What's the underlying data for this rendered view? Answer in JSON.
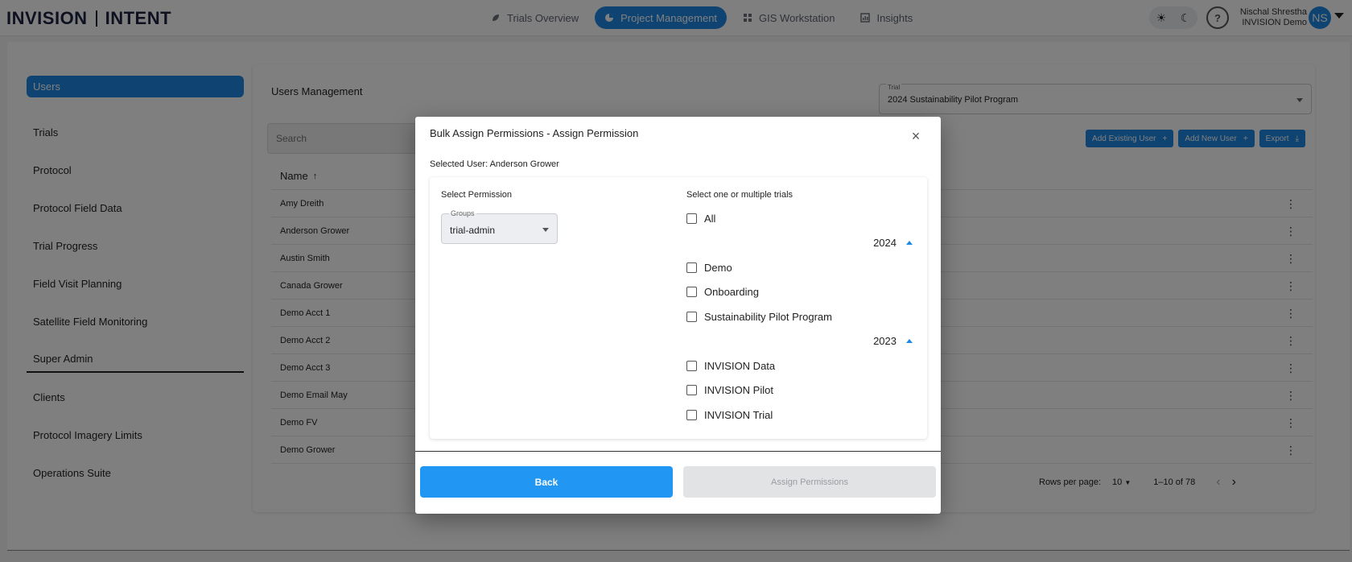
{
  "topbar": {
    "logo_left": "INVISION",
    "logo_right": "INTENT",
    "nav": [
      {
        "label": "Trials Overview",
        "icon": "leaf-icon",
        "active": false
      },
      {
        "label": "Project Management",
        "icon": "chart-pie-icon",
        "active": true
      },
      {
        "label": "GIS Workstation",
        "icon": "grid-icon",
        "active": false
      },
      {
        "label": "Insights",
        "icon": "bar-chart-icon",
        "active": false
      }
    ],
    "theme_light_icon": "☀",
    "theme_dark_icon": "☾",
    "help_icon": "?",
    "user_name": "Nischal Shrestha",
    "user_org": "INVISION Demo",
    "avatar_initials": "NS"
  },
  "sidebar": {
    "items": [
      {
        "label": "Users"
      },
      {
        "label": "Trials"
      },
      {
        "label": "Protocol"
      },
      {
        "label": "Protocol Field Data"
      },
      {
        "label": "Trial Progress"
      },
      {
        "label": "Field Visit Planning"
      },
      {
        "label": "Satellite Field Monitoring"
      }
    ],
    "section_label": "Super Admin",
    "admin_items": [
      {
        "label": "Clients"
      },
      {
        "label": "Protocol Imagery Limits"
      },
      {
        "label": "Operations Suite"
      }
    ]
  },
  "main": {
    "title": "Users Management",
    "trial_select_label": "Trial",
    "trial_select_value": "2024 Sustainability Pilot Program",
    "search_placeholder": "Search",
    "buttons": {
      "add_existing": "Add Existing User",
      "add_new": "Add New User",
      "export": "Export",
      "plus": "+",
      "export_icon": "⤓"
    },
    "table": {
      "name_header": "Name",
      "sort_icon": "↑",
      "rows": [
        "Amy Dreith",
        "Anderson Grower",
        "Austin Smith",
        "Canada Grower",
        "Demo Acct 1",
        "Demo Acct 2",
        "Demo Acct 3",
        "Demo Email May",
        "Demo FV",
        "Demo Grower"
      ]
    },
    "pager": {
      "rows_per_page_label": "Rows per page:",
      "rows_per_page_value": "10",
      "range": "1–10 of 78",
      "prev": "‹",
      "next": "›"
    }
  },
  "modal": {
    "title": "Bulk Assign Permissions - Assign Permission",
    "close": "×",
    "selected_user": "Selected User: Anderson Grower",
    "select_permission_label": "Select Permission",
    "groups_label": "Groups",
    "groups_value": "trial-admin",
    "trials_label": "Select one or multiple trials",
    "all_label": "All",
    "years": [
      {
        "year": "2024",
        "trials": [
          "Demo",
          "Onboarding",
          "Sustainability Pilot Program"
        ]
      },
      {
        "year": "2023",
        "trials": [
          "INVISION Data",
          "INVISION Pilot",
          "INVISION Trial"
        ]
      }
    ],
    "back_label": "Back",
    "assign_label": "Assign Permissions"
  }
}
